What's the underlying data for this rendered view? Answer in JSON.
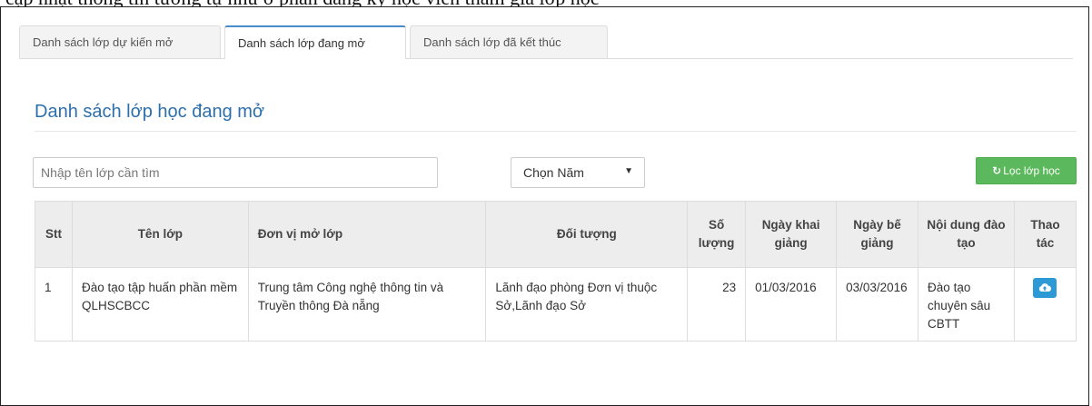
{
  "doc_header": "cập nhật thông tin tương tự như ở phần đăng ký học viên tham gia lớp học",
  "tabs": [
    {
      "label": "Danh sách lớp dự kiến mở"
    },
    {
      "label": "Danh sách lớp đang mở"
    },
    {
      "label": "Danh sách lớp đã kết thúc"
    }
  ],
  "active_tab": "Danh sách lớp đang mở",
  "panel_title": "Danh sách lớp học đang mở",
  "search": {
    "placeholder": "Nhập tên lớp cần tìm",
    "value": ""
  },
  "year_select": {
    "value": "Chọn Năm"
  },
  "filter_button": {
    "label": "Lọc lớp học",
    "icon": "refresh-icon"
  },
  "table": {
    "headers": {
      "stt": "Stt",
      "ten_lop": "Tên lớp",
      "don_vi": "Đơn vị mở lớp",
      "doi_tuong": "Đối tượng",
      "so_luong": "Số lượng",
      "ngay_khai_giang": "Ngày khai giảng",
      "ngay_be_giang": "Ngày bế giảng",
      "noi_dung": "Nội dung đào tạo",
      "thao_tac": "Thao tác"
    },
    "rows": [
      {
        "stt": "1",
        "ten_lop": "Đào tạo tập huấn phần mềm QLHSCBCC",
        "don_vi": "Trung tâm Công nghệ thông tin và Truyền thông Đà nẵng",
        "doi_tuong": "Lãnh đạo phòng Đơn vị thuộc Sở,Lãnh đạo Sở",
        "so_luong": "23",
        "ngay_khai_giang": "01/03/2016",
        "ngay_be_giang": "03/03/2016",
        "noi_dung": "Đào tạo chuyên sâu CBTT",
        "action_icon": "cloud-upload-icon"
      }
    ]
  },
  "colors": {
    "title_blue": "#2c6fad",
    "active_tab_border": "#4a8cca",
    "filter_green": "#5cb85c",
    "action_blue": "#2d9ad6",
    "header_bg": "#ededed"
  }
}
